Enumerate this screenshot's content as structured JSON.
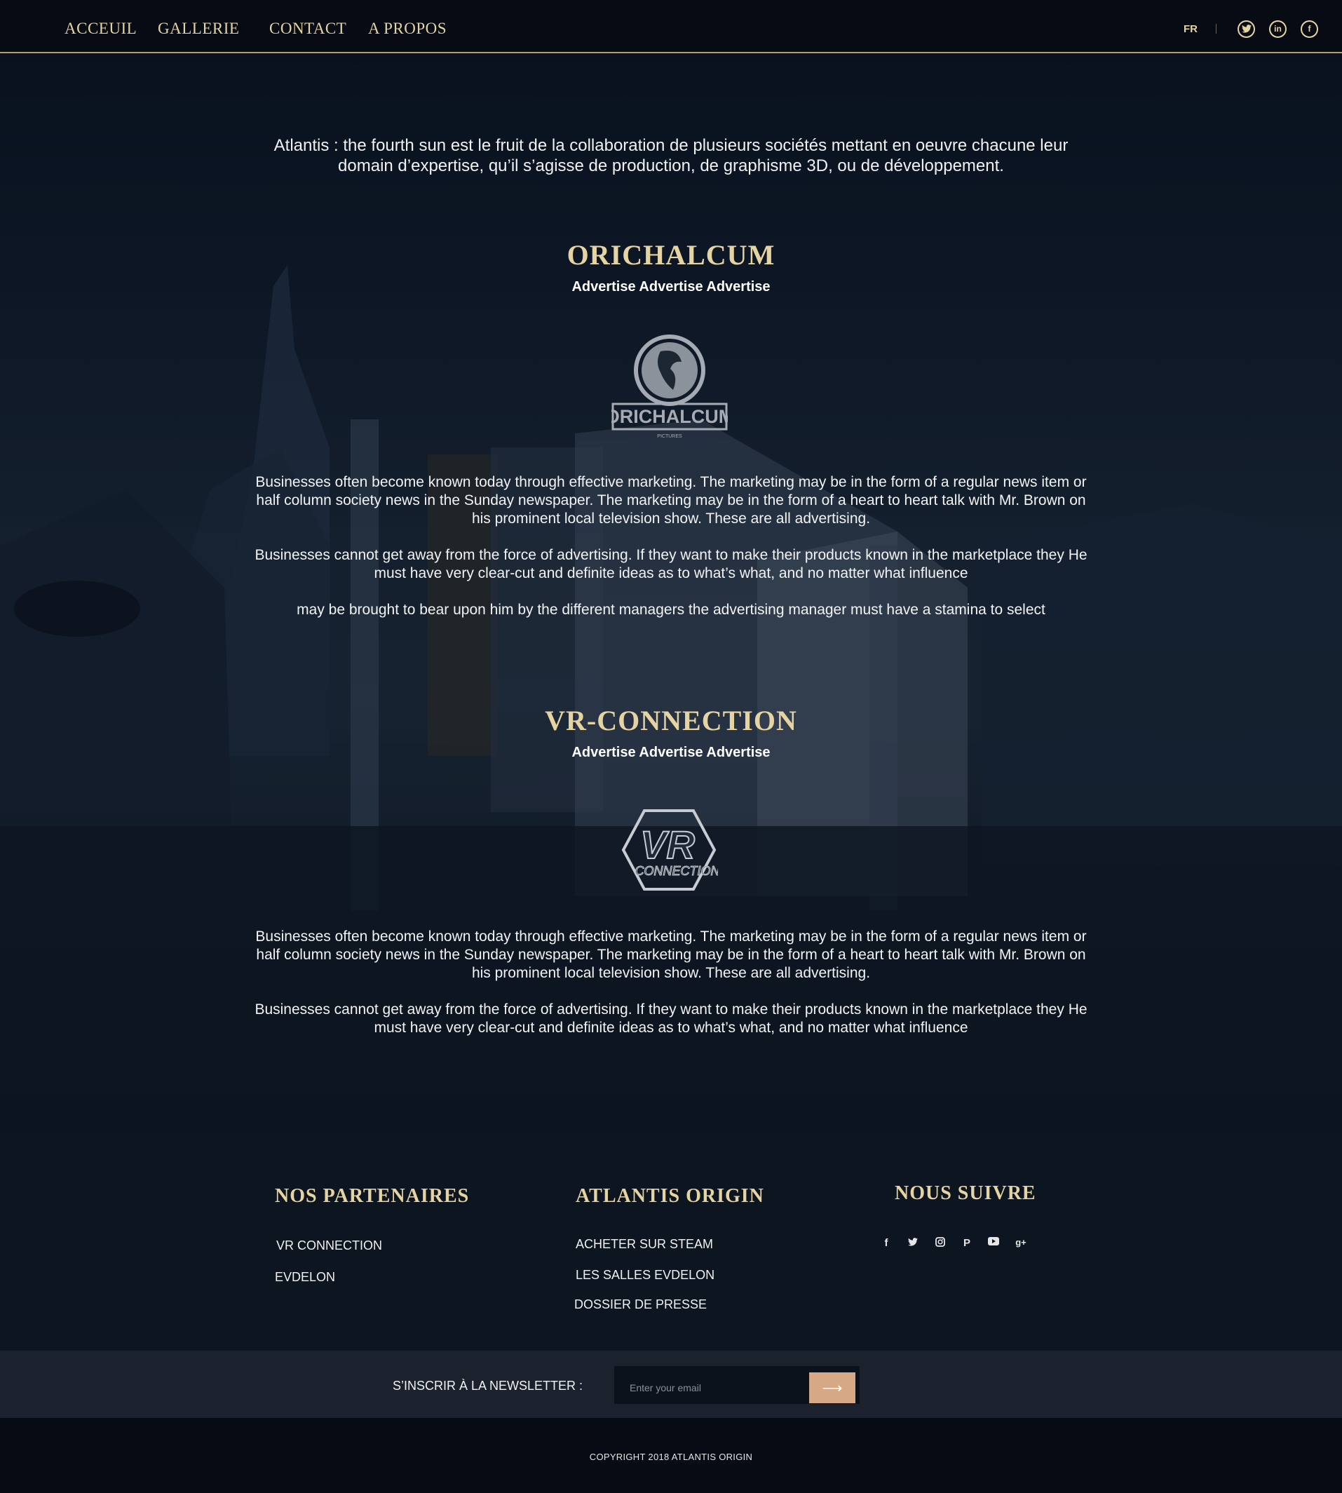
{
  "nav": {
    "links": [
      "ACCEUIL",
      "GALLERIE",
      "CONTACT",
      "A PROPOS"
    ],
    "lang": "FR",
    "social": {
      "twitter": "twitter-icon",
      "linkedin": "linkedin-icon",
      "facebook": "facebook-icon"
    }
  },
  "main": {
    "intro": "Atlantis : the fourth sun est le fruit de la collaboration de plusieurs sociétés mettant en oeuvre chacune leur domain d’expertise, qu’il s’agisse de production, de graphisme 3D, ou de développement.",
    "sections": [
      {
        "title": "ORICHALCUM",
        "subtitle": "Advertise Advertise Advertise",
        "logo_text": "ORICHALCUM",
        "logo_subtext": "PICTURES",
        "paragraphs": [
          "Businesses often become known today through effective marketing. The marketing may be in the form of a regular news item or half column society news in the Sunday newspaper. The marketing may be in the form of a heart to heart talk with Mr. Brown on his prominent local television show. These are all advertising.",
          "Businesses cannot get away from the force of advertising. If they want to make their products known in the marketplace they He must have very clear-cut and definite ideas as to what’s what, and no matter what influence",
          "may be brought to bear upon him by the different managers the advertising manager must have a stamina to select"
        ]
      },
      {
        "title": "VR-CONNECTION",
        "subtitle": "Advertise Advertise Advertise",
        "logo_text": "VR",
        "logo_subtext": "CONNECTION",
        "paragraphs": [
          "Businesses often become known today through effective marketing. The marketing may be in the form of a regular news item or half column society news in the Sunday newspaper. The marketing may be in the form of a heart to heart talk with Mr. Brown on his prominent local television show. These are all advertising.",
          "Businesses cannot get away from the force of advertising. If they want to make their products known in the marketplace they He must have very clear-cut and definite ideas as to what’s what, and no matter what influence"
        ]
      }
    ]
  },
  "footer": {
    "partners_title": "NOS PARTENAIRES",
    "partners": [
      "VR CONNECTION",
      "EVDELON"
    ],
    "origin_title": "ATLANTIS ORIGIN",
    "origin_links": [
      "ACHETER SUR STEAM",
      "LES SALLES EVDELON",
      "DOSSIER DE PRESSE"
    ],
    "follow_title": "NOUS SUIVRE",
    "follow_icons": [
      "facebook-icon",
      "twitter-icon",
      "instagram-icon",
      "pinterest-icon",
      "youtube-icon",
      "google-plus-icon"
    ]
  },
  "newsletter": {
    "label": "S’INSCRIR À LA NEWSLETTER :",
    "placeholder": "Enter your email",
    "button_arrow": "⟶"
  },
  "copyright": "COPYRIGHT 2018 ATLANTIS ORIGIN",
  "colors": {
    "gold": "#e6d3a2",
    "accent_button": "#d7a886",
    "nav_border": "#b79f73",
    "background": "#0a0f19"
  }
}
